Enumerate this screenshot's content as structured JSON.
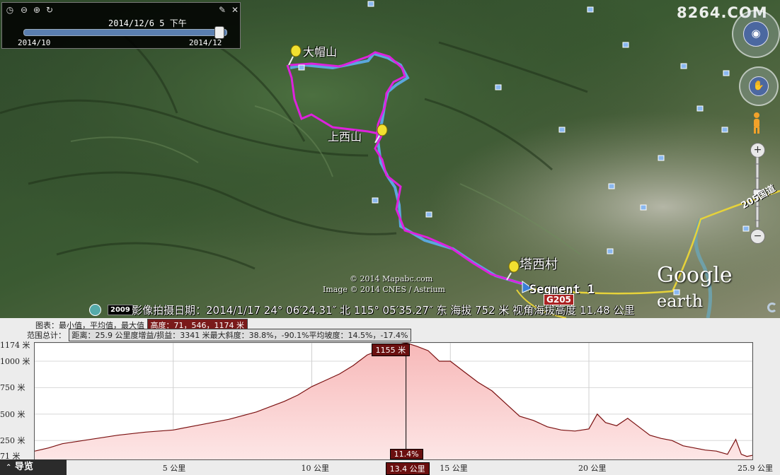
{
  "toolbar": {
    "date": "2014/12/6    5 下午",
    "range_start": "2014/10",
    "range_end": "2014/12",
    "slider_fraction": 0.96
  },
  "watermark": "8264.COM",
  "places": {
    "p1": "大帽山",
    "p2": "上西山",
    "p3": "塔西村"
  },
  "segment_label": "Segment 1",
  "road_label": "G205",
  "road_label2": "205国道",
  "copyright": {
    "line1": "© 2014 Mapabc.com",
    "line2": "Image © 2014 CNES / Astrium"
  },
  "logo": {
    "google": "Google",
    "earth": " earth"
  },
  "status": {
    "year": "2009",
    "text": "影像拍摄日期：2014/1/17   24° 06′24.31″ 北 115° 05′35.27″ 东 海拔   752 米  视角海拔高度   11.48 公里"
  },
  "profile": {
    "stats_row1_label": "图表：最小值，平均值，最大值",
    "stats_row1_value": "高度：71，546，1174 米",
    "stats_row2_label": "范围总计：",
    "stats_row2_value": "距离：25.9 公里度增益/损益：3341 米最大斜度：38.8%，-90.1%平均坡度：14.5%，-17.4%",
    "cursor_elev": "1155 米",
    "cursor_slope": "11.4%",
    "cursor_dist": "13.4 公里",
    "nav_button": "导览"
  },
  "chart_data": {
    "type": "area",
    "xlabel": "",
    "ylabel": "",
    "xlim": [
      0,
      25.9
    ],
    "ylim": [
      71,
      1174
    ],
    "yticks": [
      {
        "value": 1174,
        "label": "1174 米"
      },
      {
        "value": 1000,
        "label": "1000 米"
      },
      {
        "value": 750,
        "label": "750 米"
      },
      {
        "value": 500,
        "label": "500 米"
      },
      {
        "value": 250,
        "label": "250 米"
      },
      {
        "value": 71,
        "label": "71 米"
      }
    ],
    "xticks": [
      {
        "value": 5,
        "label": "5 公里"
      },
      {
        "value": 10,
        "label": "10 公里"
      },
      {
        "value": 15,
        "label": "15 公里"
      },
      {
        "value": 20,
        "label": "20 公里"
      },
      {
        "value": 25.9,
        "label": "25.9 公里"
      }
    ],
    "cursor_x": 13.4,
    "x": [
      0,
      0.5,
      1,
      2,
      3,
      4,
      5,
      6,
      7,
      8,
      9,
      9.5,
      10,
      10.5,
      11,
      11.5,
      12,
      12.5,
      13,
      13.4,
      13.8,
      14.2,
      14.6,
      15,
      15.5,
      16,
      16.5,
      17,
      17.5,
      18,
      18.5,
      19,
      19.5,
      20,
      20.3,
      20.6,
      21,
      21.4,
      21.8,
      22.2,
      22.6,
      23,
      23.4,
      23.8,
      24.2,
      24.6,
      25,
      25.3,
      25.5,
      25.7,
      25.9
    ],
    "y": [
      150,
      180,
      220,
      260,
      300,
      330,
      350,
      400,
      450,
      520,
      620,
      680,
      760,
      820,
      880,
      960,
      1060,
      1110,
      1150,
      1174,
      1140,
      1100,
      1000,
      1000,
      900,
      800,
      720,
      600,
      480,
      440,
      380,
      350,
      340,
      360,
      500,
      420,
      390,
      460,
      380,
      300,
      270,
      250,
      200,
      180,
      160,
      150,
      120,
      260,
      120,
      100,
      110
    ]
  }
}
